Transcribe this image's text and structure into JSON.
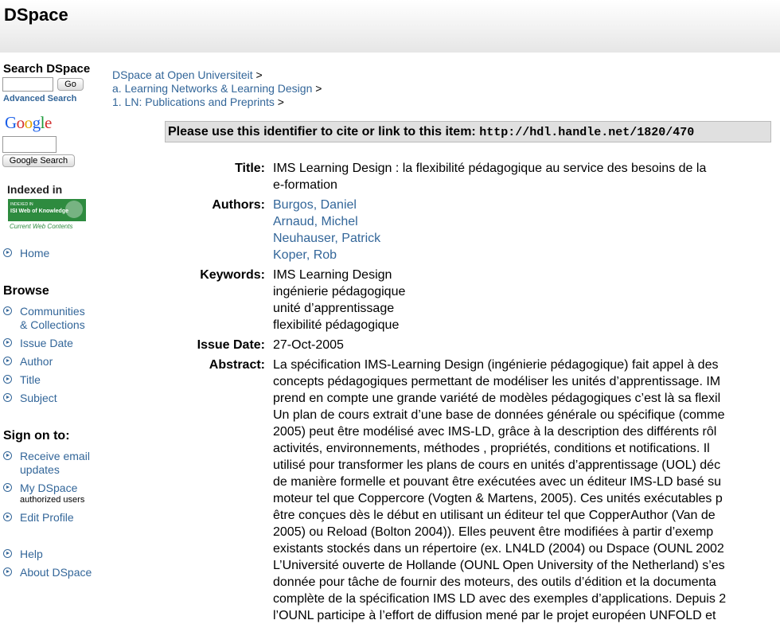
{
  "header": {
    "title": "DSpace"
  },
  "sidebar": {
    "search_heading": "Search DSpace",
    "go_button": "Go",
    "advanced_search": "Advanced Search",
    "google_logo_text": "Google",
    "google_search_button": "Google Search",
    "indexed_in": "Indexed in",
    "isi_line1": "INDEXED IN",
    "isi_line2": "ISI Web of Knowledge",
    "isi_sub": "Current Web Contents",
    "home": "Home",
    "browse_heading": "Browse",
    "browse_items": [
      "Communities",
      "& Collections",
      "Issue Date",
      "Author",
      "Title",
      "Subject"
    ],
    "sign_on_heading": "Sign on to:",
    "receive_email_1": "Receive email",
    "receive_email_2": "updates",
    "my_dspace": "My DSpace",
    "authorized_users": "authorized users",
    "edit_profile": "Edit Profile",
    "help": "Help",
    "about": "About DSpace"
  },
  "breadcrumb": [
    {
      "label": "DSpace at Open Universiteit",
      "sep": " >"
    },
    {
      "label": "a. Learning Networks & Learning Design",
      "sep": " >"
    },
    {
      "label": "1. LN: Publications and Preprints",
      "sep": " >"
    }
  ],
  "cite": {
    "text": "Please use this identifier to cite or link to this item: ",
    "url": "http://hdl.handle.net/1820/470"
  },
  "item": {
    "title_label": "Title:",
    "title_lines": [
      "IMS Learning Design : la flexibilité pédagogique au service des besoins de la",
      "e-formation"
    ],
    "authors_label": "Authors:",
    "authors": [
      "Burgos, Daniel",
      "Arnaud, Michel",
      "Neuhauser, Patrick",
      "Koper, Rob"
    ],
    "keywords_label": "Keywords:",
    "keywords": [
      "IMS Learning Design",
      "ingénierie pédagogique",
      "unité d’apprentissage",
      "flexibilité pédagogique"
    ],
    "issue_date_label": "Issue Date:",
    "issue_date": "27-Oct-2005",
    "abstract_label": "Abstract:",
    "abstract_lines": [
      "La spécification IMS-Learning Design (ingénierie pédagogique) fait appel à des",
      "concepts pédagogiques permettant de modéliser les unités d’apprentissage. IM",
      "prend en compte une grande variété de modèles pédagogiques c’est là sa flexil",
      "Un plan de cours extrait d’une base de données générale ou spécifique (comme",
      "2005) peut être modélisé avec IMS-LD, grâce à la description des différents rôl",
      "activités, environnements, méthodes , propriétés, conditions et notifications. Il",
      "utilisé pour transformer les plans de cours en unités d’apprentissage (UOL) déc",
      "de manière formelle et pouvant être exécutées avec un éditeur IMS-LD basé su",
      "moteur tel que Coppercore (Vogten & Martens, 2005). Ces unités exécutables p",
      "être conçues dès le début en utilisant un éditeur tel que CopperAuthor (Van de",
      "2005) ou Reload (Bolton 2004)). Elles peuvent être modifiées à partir d’exemp",
      "existants stockés dans un répertoire (ex. LN4LD (2004) ou Dspace (OUNL 2002",
      "L’Université ouverte de Hollande (OUNL Open University of the Netherland) s’es",
      "donnée pour tâche de fournir des moteurs, des outils d’édition et la documenta",
      "complète de la spécification IMS LD avec des exemples d’applications. Depuis 2",
      "l’OUNL participe à l’effort de diffusion mené par le projet européen UNFOLD et"
    ]
  }
}
